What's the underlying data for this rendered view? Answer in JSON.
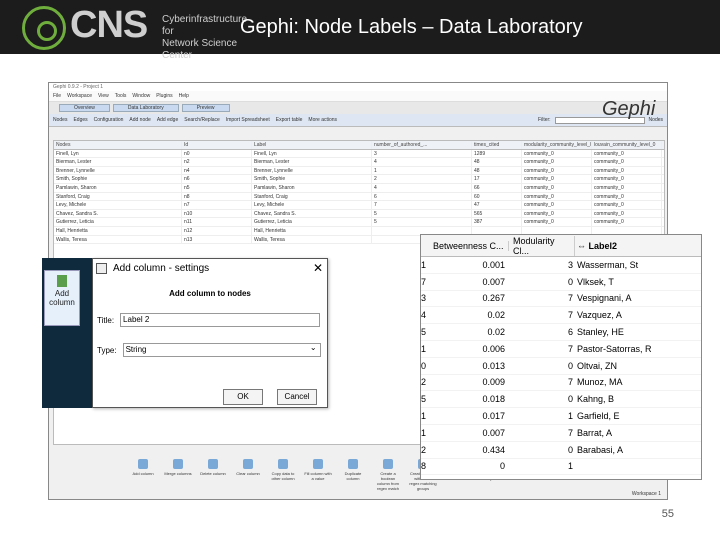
{
  "slide": {
    "title": "Gephi: Node Labels – Data Laboratory",
    "page": "55"
  },
  "logo": {
    "main": "CNS",
    "line1": "Cyberinfrastructure for",
    "line2": "Network Science Center"
  },
  "app": {
    "window_title": "Gephi 0.9.2 - Project 1",
    "menu": [
      "File",
      "Workspace",
      "View",
      "Tools",
      "Window",
      "Plugins",
      "Help"
    ],
    "tabs": [
      "Overview",
      "Data Laboratory",
      "Preview"
    ],
    "toolbar": [
      "Nodes",
      "Edges",
      "Configuration",
      "Add node",
      "Add edge",
      "Search/Replace",
      "Import Spreadsheet",
      "Export table",
      "More actions"
    ],
    "filter_label": "Filter:",
    "filter_col": "Nodes",
    "grid_headers": [
      "Nodes",
      "Id",
      "Label",
      "number_of_authored_...",
      "times_cited",
      "modularity_community_level_0",
      "louvain_community_level_0"
    ],
    "grid_rows": [
      [
        "Finell, Lyn",
        "n0",
        "Finell, Lyn",
        "3",
        "1289",
        "community_0",
        "community_0"
      ],
      [
        "Bierman, Lester",
        "n2",
        "Bierman, Lester",
        "4",
        "48",
        "community_0",
        "community_0"
      ],
      [
        "Brenner, Lynnelle",
        "n4",
        "Brenner, Lynnelle",
        "1",
        "48",
        "community_0",
        "community_0"
      ],
      [
        "Smith, Sophie",
        "n6",
        "Smith, Sophie",
        "2",
        "17",
        "community_0",
        "community_0"
      ],
      [
        "Pamlawin, Sharon",
        "n5",
        "Pamlawin, Sharon",
        "4",
        "66",
        "community_0",
        "community_0"
      ],
      [
        "Stanford, Craig",
        "n8",
        "Stanford, Craig",
        "6",
        "60",
        "community_0",
        "community_0"
      ],
      [
        "Levy, Michele",
        "n7",
        "Levy, Michele",
        "7",
        "47",
        "community_0",
        "community_0"
      ],
      [
        "Chavez, Sandra S.",
        "n10",
        "Chavez, Sandra S.",
        "5",
        "565",
        "community_0",
        "community_0"
      ],
      [
        "Gutierrez, Leticia",
        "n11",
        "Gutierrez, Leticia",
        "5",
        "387",
        "community_0",
        "community_0"
      ],
      [
        "Hall, Henrietta",
        "n12",
        "Hall, Henrietta",
        "",
        "",
        "",
        ""
      ],
      [
        "Wallis, Teresa",
        "n13",
        "Wallis, Teresa",
        "",
        "",
        "",
        ""
      ]
    ],
    "bottom_buttons": [
      "Add column",
      "Merge columns",
      "Delete column",
      "Clear column",
      "Copy data to other column",
      "Fill column with a value",
      "Duplicate column",
      "Create a boolean column from regex match",
      "Create column with list of regex matching groups",
      "Negate boolean values",
      "Convert column to dynamic"
    ],
    "status": "Workspace 1"
  },
  "sidepanel": {
    "add_column": "Add column"
  },
  "dialog": {
    "title": "Add column - settings",
    "heading": "Add column to nodes",
    "title_label": "Title:",
    "title_value": "Label 2",
    "type_label": "Type:",
    "type_value": "String",
    "ok": "OK",
    "cancel": "Cancel"
  },
  "zoom": {
    "headers": [
      "Betweenness C...",
      "Modularity Cl...",
      "Label2"
    ],
    "rows": [
      [
        "1",
        "0.001",
        "3",
        "Wasserman, St"
      ],
      [
        "7",
        "0.007",
        "0",
        "Vlksek, T"
      ],
      [
        "3",
        "0.267",
        "7",
        "Vespignani, A"
      ],
      [
        "4",
        "0.02",
        "7",
        "Vazquez, A"
      ],
      [
        "5",
        "0.02",
        "6",
        "Stanley, HE"
      ],
      [
        "1",
        "0.006",
        "7",
        "Pastor-Satorras, R"
      ],
      [
        "0",
        "0.013",
        "0",
        "Oltvai, ZN"
      ],
      [
        "2",
        "0.009",
        "7",
        "Munoz, MA"
      ],
      [
        "5",
        "0.018",
        "0",
        "Kahng, B"
      ],
      [
        "1",
        "0.017",
        "1",
        "Garfield, E"
      ],
      [
        "1",
        "0.007",
        "7",
        "Barrat, A"
      ],
      [
        "2",
        "0.434",
        "0",
        "Barabasi, A"
      ],
      [
        "8",
        "0",
        "1",
        ""
      ]
    ]
  }
}
